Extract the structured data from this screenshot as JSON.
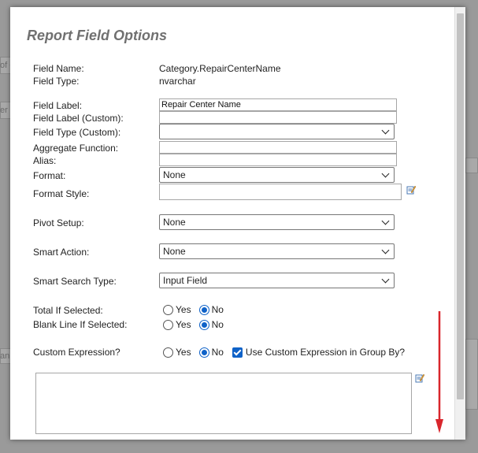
{
  "dialog": {
    "title": "Report Field Options"
  },
  "background": {
    "fragments": [
      "of C",
      "er",
      "an"
    ]
  },
  "fields": {
    "field_name_label": "Field Name:",
    "field_name_value": "Category.RepairCenterName",
    "field_type_label": "Field Type:",
    "field_type_value": "nvarchar",
    "field_label_label": "Field Label:",
    "field_label_value": "Repair Center Name",
    "field_label_custom_label": "Field Label (Custom):",
    "field_label_custom_value": "",
    "field_type_custom_label": "Field Type (Custom):",
    "field_type_custom_value": "",
    "aggregate_function_label": "Aggregate Function:",
    "aggregate_function_value": "",
    "alias_label": "Alias:",
    "alias_value": "",
    "format_label": "Format:",
    "format_value": "None",
    "format_style_label": "Format Style:",
    "format_style_value": "",
    "pivot_setup_label": "Pivot Setup:",
    "pivot_setup_value": "None",
    "smart_action_label": "Smart Action:",
    "smart_action_value": "None",
    "smart_search_type_label": "Smart Search Type:",
    "smart_search_type_value": "Input Field",
    "total_if_selected_label": "Total If Selected:",
    "blank_line_if_selected_label": "Blank Line If Selected:",
    "custom_expression_label": "Custom Expression?",
    "use_custom_expression_group_by_label": "Use Custom Expression in Group By?",
    "yes_label": "Yes",
    "no_label": "No",
    "total_if_selected": "No",
    "blank_line_if_selected": "No",
    "custom_expression": "No",
    "use_custom_expression_group_by": true,
    "custom_expression_text": ""
  },
  "icons": {
    "format_style_editor": "edit-icon",
    "custom_expression_editor": "edit-icon"
  },
  "colors": {
    "accent": "#0f62c8",
    "title": "#707070",
    "annotation_arrow": "#d9262c"
  }
}
